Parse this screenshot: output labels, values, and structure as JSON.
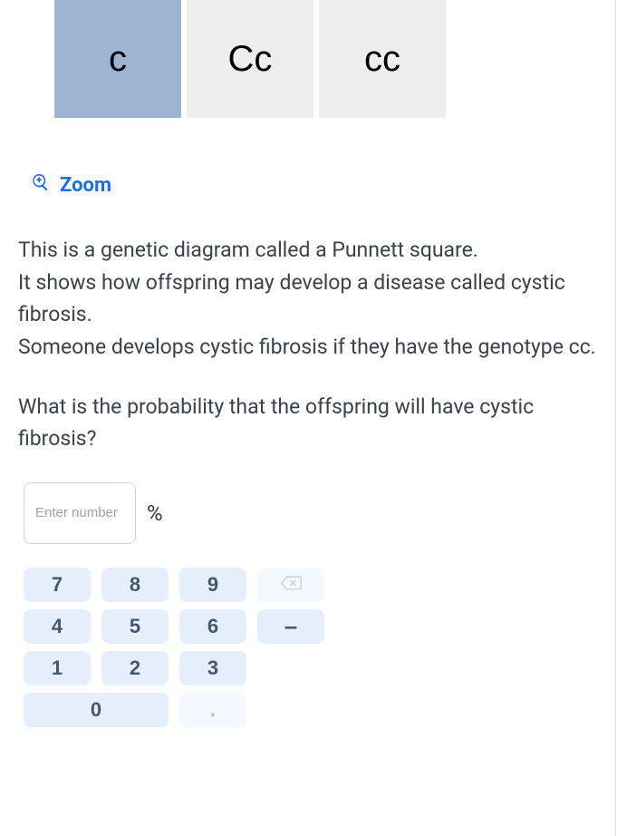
{
  "punnett": {
    "cells": [
      {
        "label": "c",
        "selected": true
      },
      {
        "label": "Cc",
        "selected": false
      },
      {
        "label": "cc",
        "selected": false
      }
    ]
  },
  "zoom": {
    "label": "Zoom"
  },
  "passage": {
    "line1": "This is a genetic diagram called a Punnett square.",
    "line2": "It shows how offspring may develop a disease called cystic fibrosis.",
    "line3": "Someone develops cystic fibrosis if they have the genotype cc."
  },
  "question": "What is the probability that the offspring will have cystic fibrosis?",
  "answer": {
    "placeholder": "Enter number",
    "value": "",
    "unit": "%"
  },
  "keypad": {
    "k7": "7",
    "k8": "8",
    "k9": "9",
    "k4": "4",
    "k5": "5",
    "k6": "6",
    "k1": "1",
    "k2": "2",
    "k3": "3",
    "k0": "0",
    "minus": "–",
    "dot": "."
  }
}
